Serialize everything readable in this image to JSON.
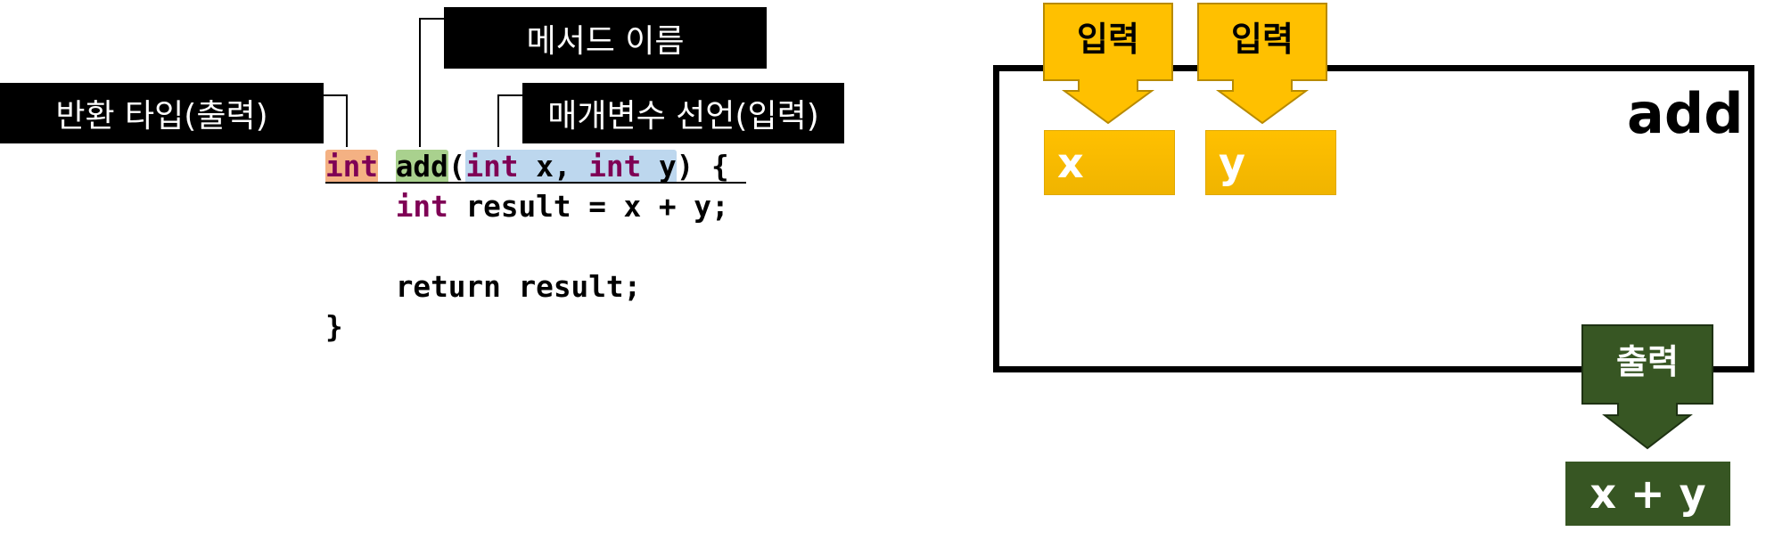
{
  "callouts": {
    "method_name": "메서드 이름",
    "return_type": "반환 타입(출력)",
    "parameters": "매개변수 선언(입력)"
  },
  "code": {
    "ret_type": "int",
    "method_name": "add",
    "open_paren": "(",
    "param1_type": "int",
    "param1_name": " x, ",
    "param2_type": "int",
    "param2_name": " y",
    "sig_end": ") {",
    "line2_indent": "    ",
    "line2_kw": "int",
    "line2_rest": " result = x + y;",
    "line4": "    return result;",
    "line5": "}"
  },
  "diagram": {
    "method_name": "add",
    "input_label_1": "입력",
    "input_label_2": "입력",
    "var_x": "x",
    "var_y": "y",
    "output_label": "출력",
    "result_expr": "x + y",
    "colors": {
      "input_arrow": "#ffc000",
      "input_arrow_border": "#b88a00",
      "output_arrow": "#375623",
      "output_arrow_border": "#1e3213"
    }
  }
}
